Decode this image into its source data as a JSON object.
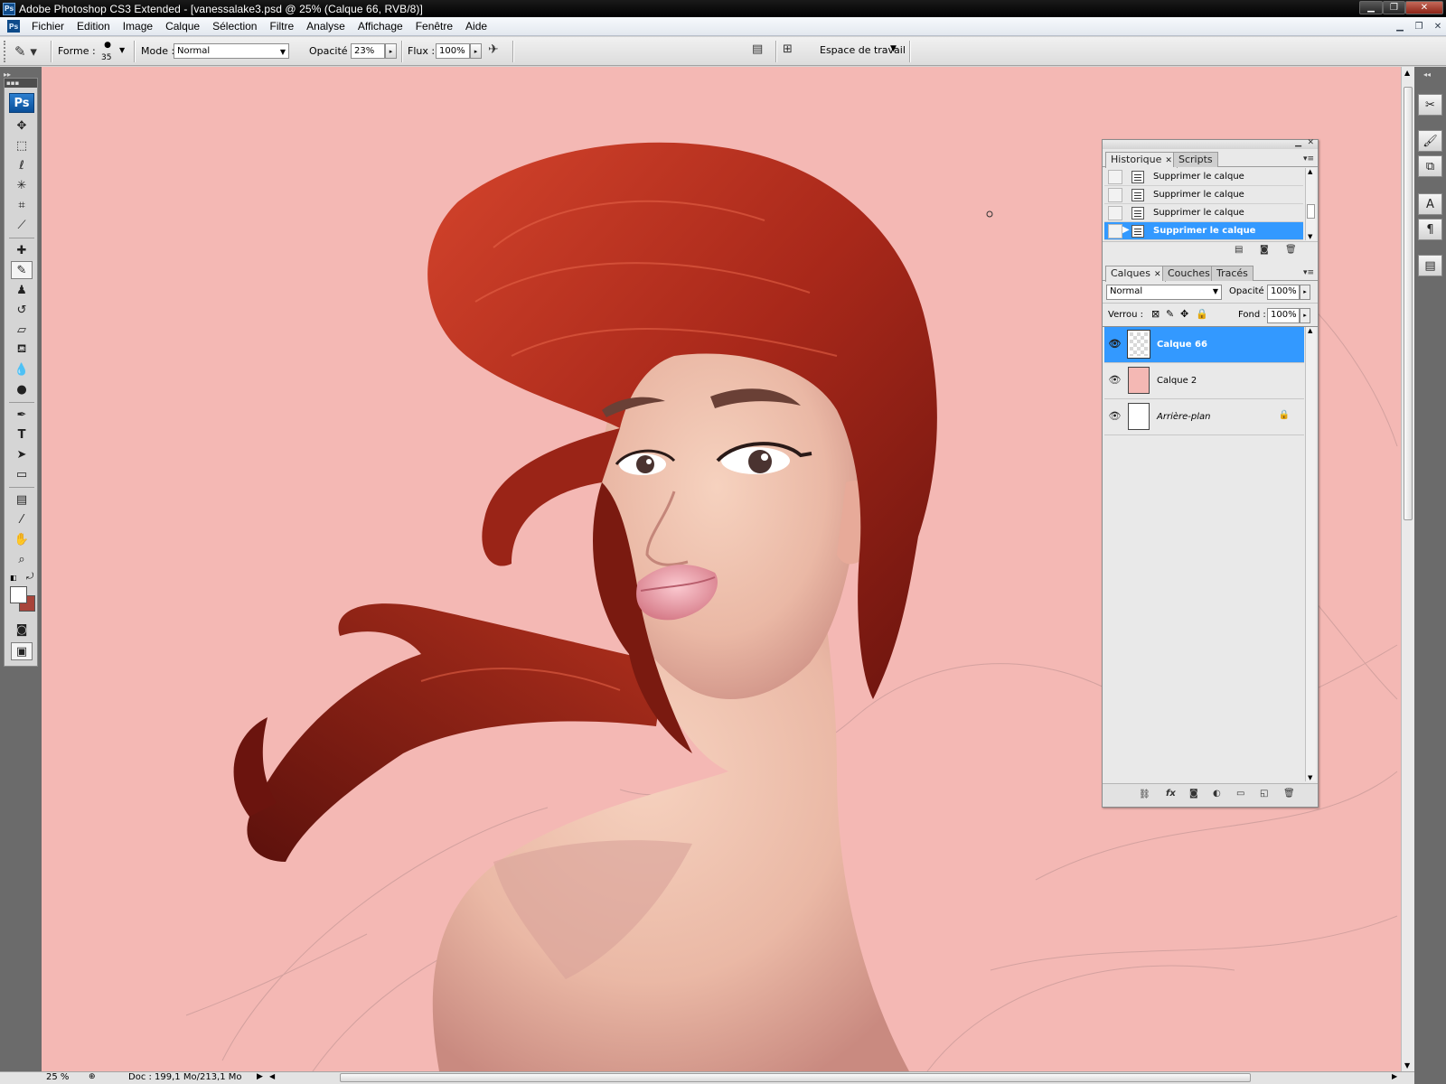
{
  "window": {
    "title": "Adobe Photoshop CS3 Extended - [vanessalake3.psd @ 25% (Calque 66, RVB/8)]",
    "app_icon": "Ps"
  },
  "menubar": {
    "items": [
      "Fichier",
      "Edition",
      "Image",
      "Calque",
      "Sélection",
      "Filtre",
      "Analyse",
      "Affichage",
      "Fenêtre",
      "Aide"
    ]
  },
  "options": {
    "forme_label": "Forme :",
    "brush_size": "35",
    "mode_label": "Mode :",
    "mode_value": "Normal",
    "opacity_label": "Opacité :",
    "opacity_value": "23%",
    "flux_label": "Flux :",
    "flux_value": "100%",
    "workspace_label": "Espace de travail"
  },
  "toolbox": {
    "logo": "Ps"
  },
  "history_panel": {
    "tabs": [
      "Historique",
      "Scripts"
    ],
    "rows": [
      {
        "label": "Supprimer le calque",
        "selected": false
      },
      {
        "label": "Supprimer le calque",
        "selected": false
      },
      {
        "label": "Supprimer le calque",
        "selected": false
      },
      {
        "label": "Supprimer le calque",
        "selected": true
      }
    ]
  },
  "layers_panel": {
    "tabs": [
      "Calques",
      "Couches",
      "Tracés"
    ],
    "blend_mode": "Normal",
    "opacity_label": "Opacité :",
    "opacity_value": "100%",
    "lock_label": "Verrou :",
    "fill_label": "Fond :",
    "fill_value": "100%",
    "layers": [
      {
        "name": "Calque 66",
        "selected": true,
        "thumb": "checker"
      },
      {
        "name": "Calque 2",
        "selected": false,
        "thumb": "#f4b8b4"
      },
      {
        "name": "Arrière-plan",
        "selected": false,
        "thumb": "#ffffff",
        "locked": true
      }
    ],
    "bottom_icons": [
      "link-icon",
      "fx-icon",
      "mask-icon",
      "adjustment-icon",
      "folder-icon",
      "new-layer-icon",
      "trash-icon"
    ]
  },
  "statusbar": {
    "zoom": "25 %",
    "doc_info": "Doc : 199,1 Mo/213,1 Mo"
  },
  "colors": {
    "canvas_bg": "#f4b8b4",
    "selection": "#3399ff",
    "foreground_swatch": "#ffffff",
    "background_swatch": "#a8443a"
  }
}
